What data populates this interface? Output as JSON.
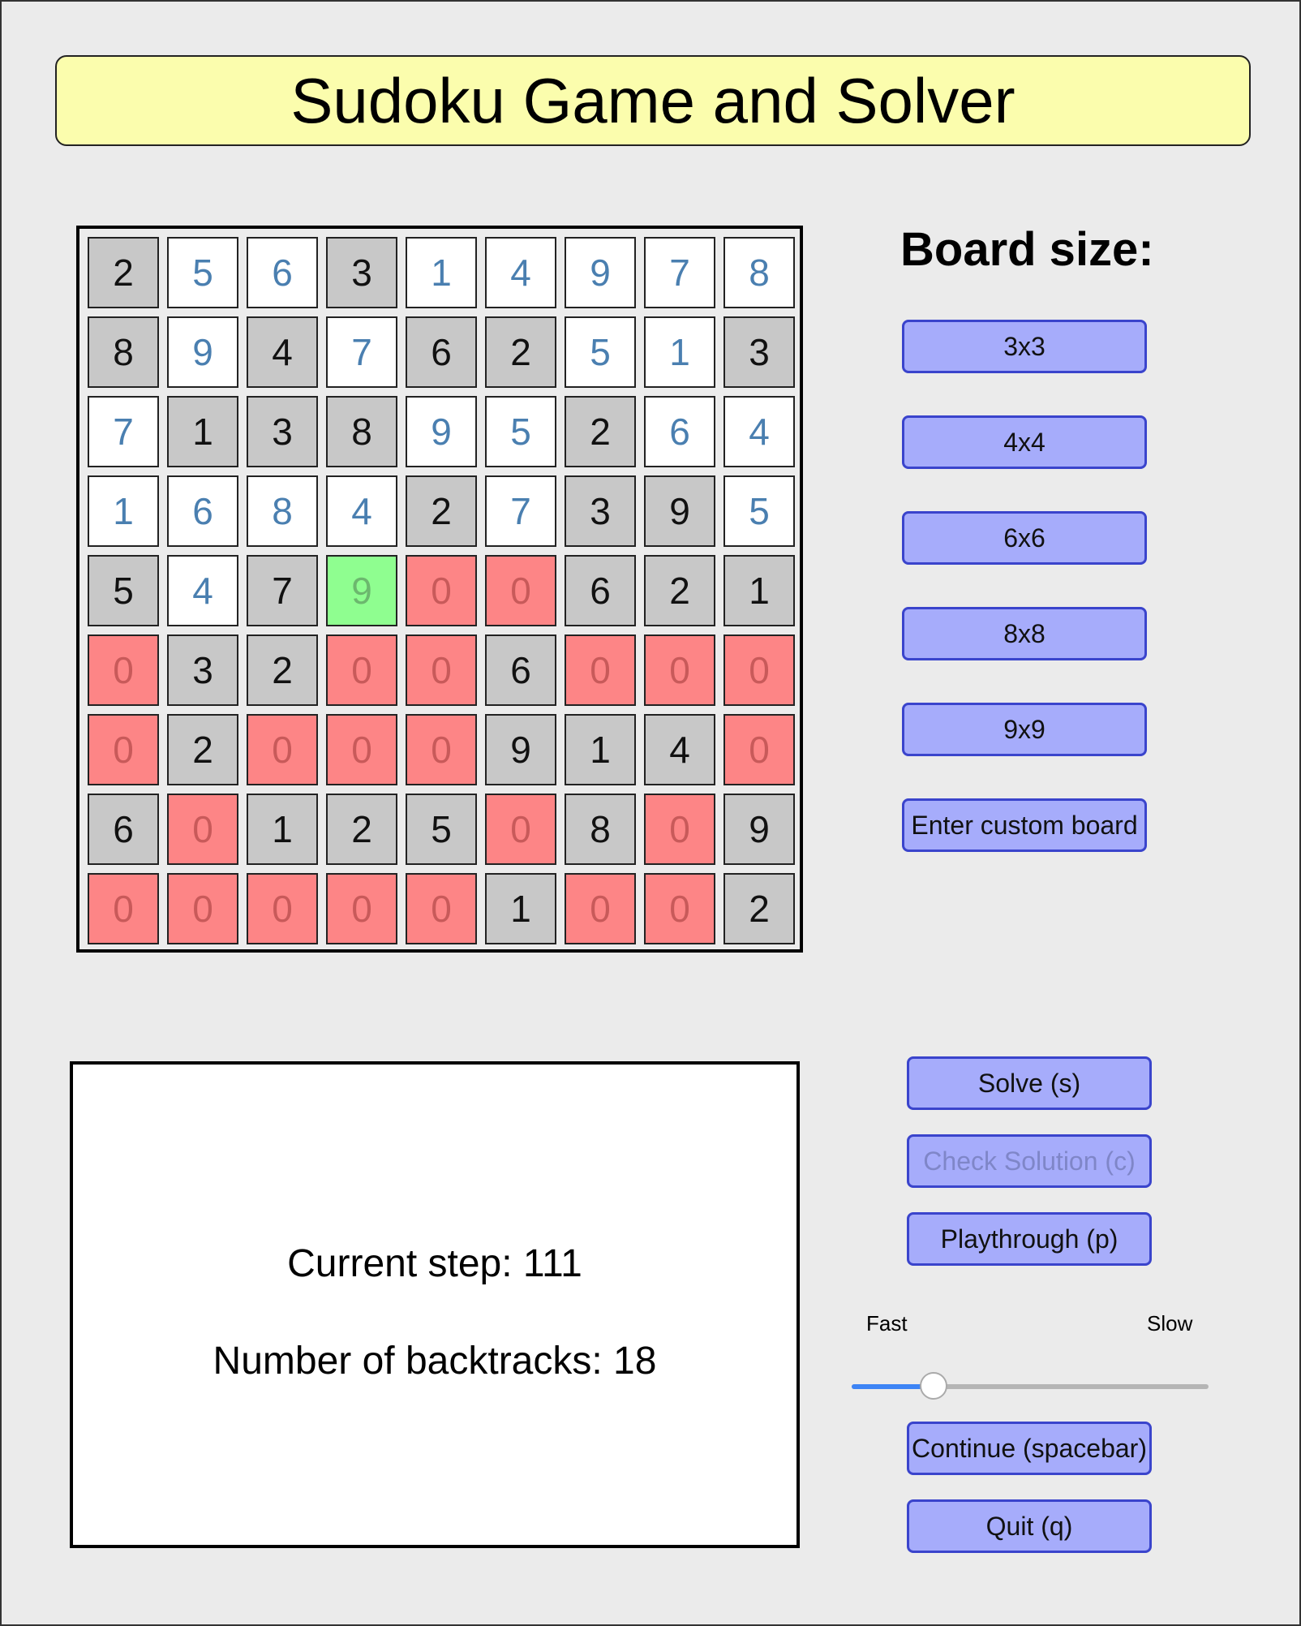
{
  "app": {
    "title": "Sudoku Game and Solver"
  },
  "board": {
    "cells": [
      [
        {
          "v": "2",
          "s": "given"
        },
        {
          "v": "5",
          "s": "filled"
        },
        {
          "v": "6",
          "s": "filled"
        },
        {
          "v": "3",
          "s": "given"
        },
        {
          "v": "1",
          "s": "filled"
        },
        {
          "v": "4",
          "s": "filled"
        },
        {
          "v": "9",
          "s": "filled"
        },
        {
          "v": "7",
          "s": "filled"
        },
        {
          "v": "8",
          "s": "filled"
        }
      ],
      [
        {
          "v": "8",
          "s": "given"
        },
        {
          "v": "9",
          "s": "filled"
        },
        {
          "v": "4",
          "s": "given"
        },
        {
          "v": "7",
          "s": "filled"
        },
        {
          "v": "6",
          "s": "given"
        },
        {
          "v": "2",
          "s": "given"
        },
        {
          "v": "5",
          "s": "filled"
        },
        {
          "v": "1",
          "s": "filled"
        },
        {
          "v": "3",
          "s": "given"
        }
      ],
      [
        {
          "v": "7",
          "s": "filled"
        },
        {
          "v": "1",
          "s": "given"
        },
        {
          "v": "3",
          "s": "given"
        },
        {
          "v": "8",
          "s": "given"
        },
        {
          "v": "9",
          "s": "filled"
        },
        {
          "v": "5",
          "s": "filled"
        },
        {
          "v": "2",
          "s": "given"
        },
        {
          "v": "6",
          "s": "filled"
        },
        {
          "v": "4",
          "s": "filled"
        }
      ],
      [
        {
          "v": "1",
          "s": "filled"
        },
        {
          "v": "6",
          "s": "filled"
        },
        {
          "v": "8",
          "s": "filled"
        },
        {
          "v": "4",
          "s": "filled"
        },
        {
          "v": "2",
          "s": "given"
        },
        {
          "v": "7",
          "s": "filled"
        },
        {
          "v": "3",
          "s": "given"
        },
        {
          "v": "9",
          "s": "given"
        },
        {
          "v": "5",
          "s": "filled"
        }
      ],
      [
        {
          "v": "5",
          "s": "given"
        },
        {
          "v": "4",
          "s": "filled"
        },
        {
          "v": "7",
          "s": "given"
        },
        {
          "v": "9",
          "s": "current"
        },
        {
          "v": "0",
          "s": "error"
        },
        {
          "v": "0",
          "s": "error"
        },
        {
          "v": "6",
          "s": "given"
        },
        {
          "v": "2",
          "s": "given"
        },
        {
          "v": "1",
          "s": "given"
        }
      ],
      [
        {
          "v": "0",
          "s": "error"
        },
        {
          "v": "3",
          "s": "given"
        },
        {
          "v": "2",
          "s": "given"
        },
        {
          "v": "0",
          "s": "error"
        },
        {
          "v": "0",
          "s": "error"
        },
        {
          "v": "6",
          "s": "given"
        },
        {
          "v": "0",
          "s": "error"
        },
        {
          "v": "0",
          "s": "error"
        },
        {
          "v": "0",
          "s": "error"
        }
      ],
      [
        {
          "v": "0",
          "s": "error"
        },
        {
          "v": "2",
          "s": "given"
        },
        {
          "v": "0",
          "s": "error"
        },
        {
          "v": "0",
          "s": "error"
        },
        {
          "v": "0",
          "s": "error"
        },
        {
          "v": "9",
          "s": "given"
        },
        {
          "v": "1",
          "s": "given"
        },
        {
          "v": "4",
          "s": "given"
        },
        {
          "v": "0",
          "s": "error"
        }
      ],
      [
        {
          "v": "6",
          "s": "given"
        },
        {
          "v": "0",
          "s": "error"
        },
        {
          "v": "1",
          "s": "given"
        },
        {
          "v": "2",
          "s": "given"
        },
        {
          "v": "5",
          "s": "given"
        },
        {
          "v": "0",
          "s": "error"
        },
        {
          "v": "8",
          "s": "given"
        },
        {
          "v": "0",
          "s": "error"
        },
        {
          "v": "9",
          "s": "given"
        }
      ],
      [
        {
          "v": "0",
          "s": "error"
        },
        {
          "v": "0",
          "s": "error"
        },
        {
          "v": "0",
          "s": "error"
        },
        {
          "v": "0",
          "s": "error"
        },
        {
          "v": "0",
          "s": "error"
        },
        {
          "v": "1",
          "s": "given"
        },
        {
          "v": "0",
          "s": "error"
        },
        {
          "v": "0",
          "s": "error"
        },
        {
          "v": "2",
          "s": "given"
        }
      ]
    ]
  },
  "size_panel": {
    "label": "Board size:",
    "buttons": [
      "3x3",
      "4x4",
      "6x6",
      "8x8",
      "9x9",
      "Enter custom board"
    ]
  },
  "info": {
    "step_label": "Current step: 111",
    "backtracks_label": "Number of backtracks: 18"
  },
  "controls": {
    "solve": "Solve (s)",
    "check": "Check Solution (c)",
    "playthrough": "Playthrough (p)",
    "continue": "Continue (spacebar)",
    "quit": "Quit (q)"
  },
  "speed": {
    "fast_label": "Fast",
    "slow_label": "Slow",
    "value": 0.23
  },
  "colors": {
    "title_bg": "#fbfdad",
    "given_cell": "#c8c8c8",
    "filled_cell": "#ffffff",
    "error_cell": "#fd8586",
    "current_cell": "#8ffe90",
    "button_bg": "#a6acfb",
    "button_border": "#3a44cc",
    "slider_fill": "#3d84f5"
  }
}
